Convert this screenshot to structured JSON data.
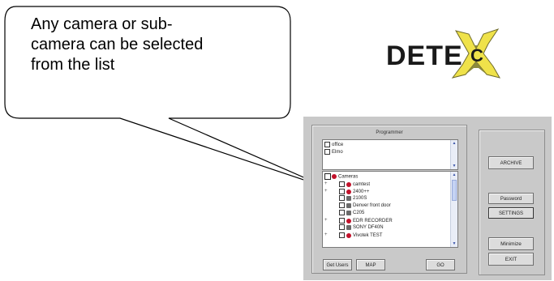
{
  "callout": {
    "line1": "Any camera or sub-",
    "line2": "camera can be selected",
    "line3": "from the list"
  },
  "logo": {
    "text": "DETE",
    "mark_icon": "x-burst-logo-icon"
  },
  "programmer": {
    "title": "Programmer",
    "users": [
      "office",
      "Elmo"
    ],
    "cameras_root": "Cameras",
    "cameras": [
      {
        "label": "camtest",
        "expandable": true
      },
      {
        "label": "2400++",
        "expandable": true
      },
      {
        "label": "2100S",
        "expandable": false
      },
      {
        "label": "Denver front door",
        "expandable": false
      },
      {
        "label": "C205",
        "expandable": false
      },
      {
        "label": "EDR RECORDER",
        "expandable": true
      },
      {
        "label": "SONY DF40N",
        "expandable": false
      },
      {
        "label": "Vivotek TEST",
        "expandable": true
      }
    ],
    "get_users_label": "Get Users",
    "map_label": "MAP",
    "go_label": "GO"
  },
  "side_buttons": {
    "archive": "ARCHIVE",
    "password": "Password",
    "settings": "SETTINGS",
    "minimize": "Minimize",
    "exit": "EXIT"
  },
  "colors": {
    "camera_red": "#c2122b",
    "window_gray": "#c9c9c9",
    "scroll_blue": "#c5d3f4"
  }
}
